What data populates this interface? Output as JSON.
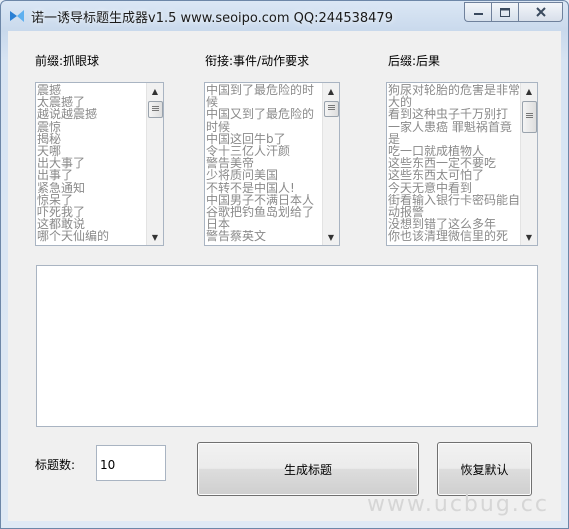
{
  "window": {
    "title": "诺一诱导标题生成器v1.5 www.seoipo.com QQ:244538479"
  },
  "prefix": {
    "label": "前缀:抓眼球",
    "items": [
      "震撼",
      "太震撼了",
      "越说越震撼",
      "震惊",
      "揭秘",
      "天哪",
      "出大事了",
      "出事了",
      "紧急通知",
      "惊呆了",
      "吓死我了",
      "这都敢说",
      "哪个天仙编的"
    ]
  },
  "middle": {
    "label": "衔接:事件/动作要求",
    "items": [
      "中国到了最危险的时候",
      "中国又到了最危险的时候",
      "中国这回牛b了",
      "令十三亿人汗颜",
      "警告美帝",
      "少将质问美国",
      "不转不是中国人!",
      "中国男子不满日本人",
      "谷歌把钓鱼岛划给了日本",
      "警告蔡英文"
    ]
  },
  "suffix": {
    "label": "后缀:后果",
    "items": [
      "狗尿对轮胎的危害是非常大的",
      "看到这种虫子千万别打",
      "一家人患癌 罪魁祸首竟是",
      "吃一口就成植物人",
      "这些东西一定不要吃",
      "这些东西太可怕了",
      "今天无意中看到",
      "街看输入银行卡密码能自动报警",
      "没想到错了这么多年",
      "你也该清理微信里的死"
    ]
  },
  "output": {
    "text": ""
  },
  "count": {
    "label": "标题数:",
    "value": "10"
  },
  "buttons": {
    "generate": "生成标题",
    "reset": "恢复默认"
  },
  "watermark": "www.ucbug.cc",
  "colors": {
    "title_bar": "#c9d9ec",
    "client_bg": "#f0f0f0",
    "list_text": "#8a8a8a"
  }
}
